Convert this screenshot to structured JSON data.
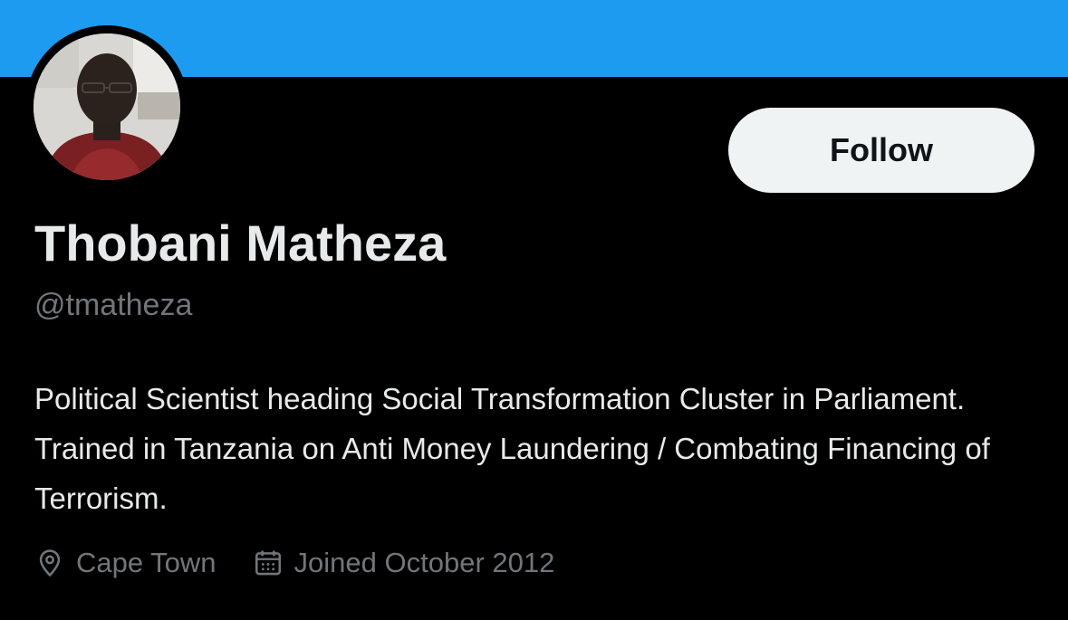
{
  "profile": {
    "display_name": "Thobani Matheza",
    "handle": "@tmatheza",
    "bio": "Political Scientist heading Social Transformation Cluster in Parliament. Trained in Tanzania on Anti Money Laundering / Combating Financing of Terrorism.",
    "location": "Cape Town",
    "joined": "Joined October 2012",
    "avatar": "profile-photo"
  },
  "actions": {
    "follow_label": "Follow"
  },
  "icons": {
    "location": "location-pin-icon",
    "joined": "calendar-icon"
  },
  "colors": {
    "banner": "#1d9bf0",
    "background": "#000000",
    "primary_text": "#e7e9ea",
    "secondary_text": "#71767b",
    "follow_button_bg": "#eff3f4",
    "follow_button_text": "#0f1419"
  }
}
